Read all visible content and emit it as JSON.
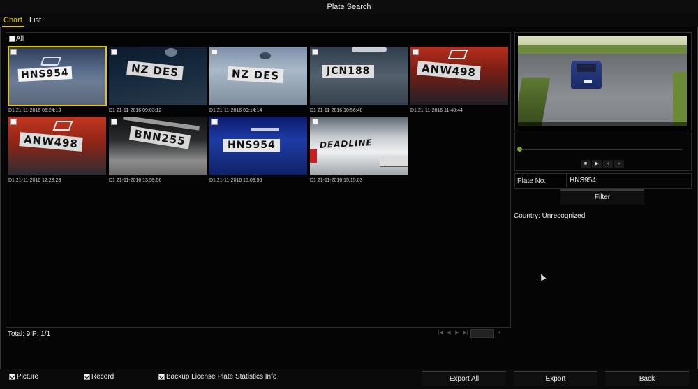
{
  "window": {
    "title": "Plate Search"
  },
  "tabs": [
    {
      "label": "Chart",
      "active": true
    },
    {
      "label": "List",
      "active": false
    }
  ],
  "select_all": {
    "label": "All",
    "checked": false
  },
  "results": [
    {
      "caption": "D1 21-11-2016 06:24:13",
      "plate_text": "HNS954",
      "selected": true
    },
    {
      "caption": "D1 21-11-2016 09:03:12",
      "plate_text": "NZ DES",
      "selected": false
    },
    {
      "caption": "D1 21-11-2016 09:14:14",
      "plate_text": "NZ DES",
      "selected": false
    },
    {
      "caption": "D1 21-11-2016 10:56:48",
      "plate_text": "JCN188",
      "selected": false
    },
    {
      "caption": "D1 21-11-2016 11:48:44",
      "plate_text": "ANW498",
      "selected": false
    },
    {
      "caption": "D1 21-11-2016 12:28:28",
      "plate_text": "ANW498",
      "selected": false
    },
    {
      "caption": "D1 21-11-2016 13:59:56",
      "plate_text": "BNN255",
      "selected": false
    },
    {
      "caption": "D1 21-11-2016 15:09:56",
      "plate_text": "HNS954",
      "selected": false
    },
    {
      "caption": "D1 21-11-2016 15:15:03",
      "plate_text": "DEADLINE",
      "selected": false
    }
  ],
  "footer": {
    "total": "Total: 9  P: 1/1"
  },
  "plate_no": {
    "label": "Plate No.",
    "value": "HNS954"
  },
  "filter_button": "Filter",
  "country": "Country: Unrecognized",
  "options": [
    {
      "label": "Picture",
      "checked": true
    },
    {
      "label": "Record",
      "checked": true
    },
    {
      "label": "Backup License Plate Statistics Info",
      "checked": true
    }
  ],
  "buttons": {
    "export_all": "Export All",
    "export": "Export",
    "back": "Back"
  },
  "icons": {
    "playback": [
      "stop-icon",
      "play-icon",
      "prev-frame-icon",
      "next-frame-icon"
    ]
  },
  "colors": {
    "accent": "#e4c700",
    "progress_knob": "#7fae2f"
  }
}
